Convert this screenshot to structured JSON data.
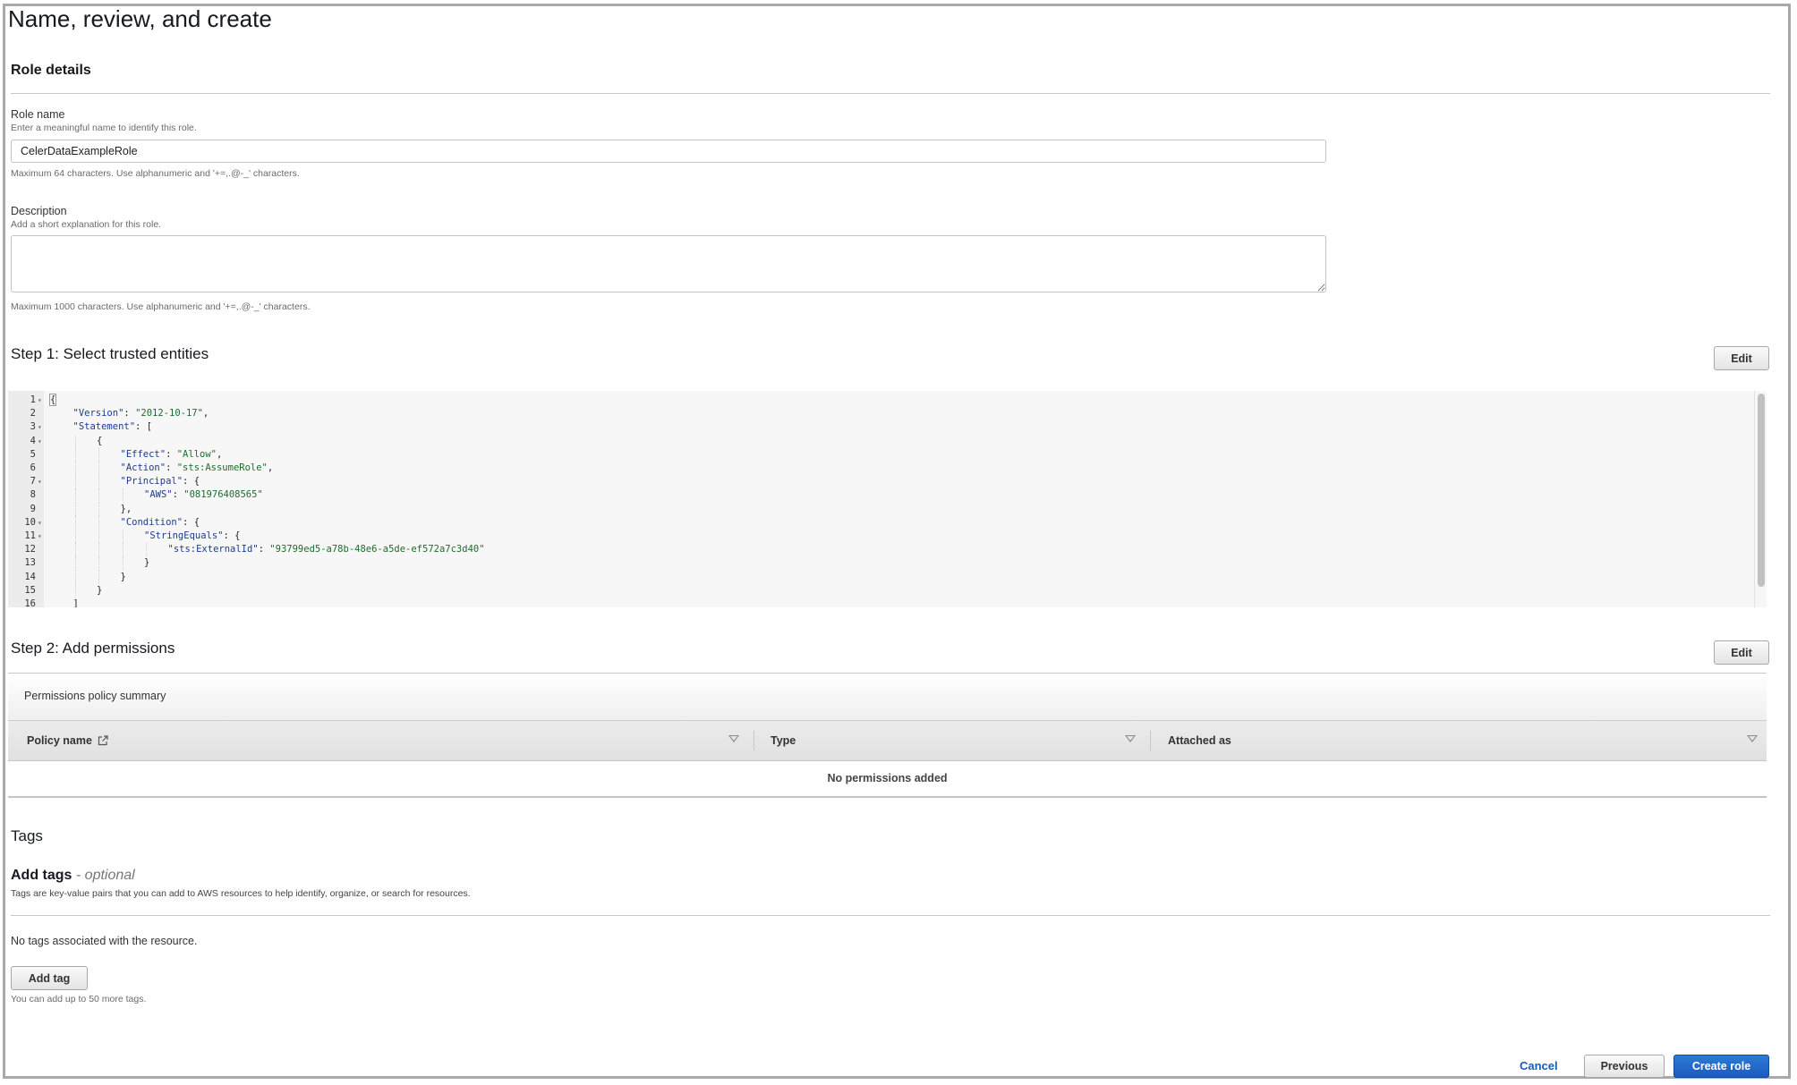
{
  "page": {
    "title": "Name, review, and create"
  },
  "role_details": {
    "heading": "Role details",
    "role_name": {
      "label": "Role name",
      "hint": "Enter a meaningful name to identify this role.",
      "value": "CelerDataExampleRole",
      "constraint": "Maximum 64 characters. Use alphanumeric and '+=,.@-_' characters."
    },
    "description": {
      "label": "Description",
      "hint": "Add a short explanation for this role.",
      "value": "",
      "constraint": "Maximum 1000 characters. Use alphanumeric and '+=,.@-_' characters."
    }
  },
  "step1": {
    "heading": "Step 1: Select trusted entities",
    "edit_label": "Edit",
    "code_lines": [
      {
        "n": "1",
        "fold": true,
        "indent": 0,
        "parts": [
          [
            "p",
            "{"
          ]
        ]
      },
      {
        "n": "2",
        "fold": false,
        "indent": 1,
        "parts": [
          [
            "k",
            "\"Version\""
          ],
          [
            "p",
            ": "
          ],
          [
            "s",
            "\"2012-10-17\""
          ],
          [
            "p",
            ","
          ]
        ]
      },
      {
        "n": "3",
        "fold": true,
        "indent": 1,
        "parts": [
          [
            "k",
            "\"Statement\""
          ],
          [
            "p",
            ": ["
          ]
        ]
      },
      {
        "n": "4",
        "fold": true,
        "indent": 2,
        "parts": [
          [
            "p",
            "{"
          ]
        ]
      },
      {
        "n": "5",
        "fold": false,
        "indent": 3,
        "parts": [
          [
            "k",
            "\"Effect\""
          ],
          [
            "p",
            ": "
          ],
          [
            "s",
            "\"Allow\""
          ],
          [
            "p",
            ","
          ]
        ]
      },
      {
        "n": "6",
        "fold": false,
        "indent": 3,
        "parts": [
          [
            "k",
            "\"Action\""
          ],
          [
            "p",
            ": "
          ],
          [
            "s",
            "\"sts:AssumeRole\""
          ],
          [
            "p",
            ","
          ]
        ]
      },
      {
        "n": "7",
        "fold": true,
        "indent": 3,
        "parts": [
          [
            "k",
            "\"Principal\""
          ],
          [
            "p",
            ": {"
          ]
        ]
      },
      {
        "n": "8",
        "fold": false,
        "indent": 4,
        "parts": [
          [
            "k",
            "\"AWS\""
          ],
          [
            "p",
            ": "
          ],
          [
            "s",
            "\"081976408565\""
          ]
        ]
      },
      {
        "n": "9",
        "fold": false,
        "indent": 3,
        "parts": [
          [
            "p",
            "},"
          ]
        ]
      },
      {
        "n": "10",
        "fold": true,
        "indent": 3,
        "parts": [
          [
            "k",
            "\"Condition\""
          ],
          [
            "p",
            ": {"
          ]
        ]
      },
      {
        "n": "11",
        "fold": true,
        "indent": 4,
        "parts": [
          [
            "k",
            "\"StringEquals\""
          ],
          [
            "p",
            ": {"
          ]
        ]
      },
      {
        "n": "12",
        "fold": false,
        "indent": 5,
        "parts": [
          [
            "k",
            "\"sts:ExternalId\""
          ],
          [
            "p",
            ": "
          ],
          [
            "s",
            "\"93799ed5-a78b-48e6-a5de-ef572a7c3d40\""
          ]
        ]
      },
      {
        "n": "13",
        "fold": false,
        "indent": 4,
        "parts": [
          [
            "p",
            "}"
          ]
        ]
      },
      {
        "n": "14",
        "fold": false,
        "indent": 3,
        "parts": [
          [
            "p",
            "}"
          ]
        ]
      },
      {
        "n": "15",
        "fold": false,
        "indent": 2,
        "parts": [
          [
            "p",
            "}"
          ]
        ]
      },
      {
        "n": "16",
        "fold": false,
        "indent": 1,
        "parts": [
          [
            "p",
            "]"
          ]
        ]
      }
    ]
  },
  "step2": {
    "heading": "Step 2: Add permissions",
    "edit_label": "Edit",
    "summary_title": "Permissions policy summary",
    "columns": [
      "Policy name",
      "Type",
      "Attached as"
    ],
    "empty_message": "No permissions added"
  },
  "tags": {
    "heading": "Tags",
    "add_tags_title": "Add tags",
    "add_tags_optional": "- optional",
    "description": "Tags are key-value pairs that you can add to AWS resources to help identify, organize, or search for resources.",
    "empty_message": "No tags associated with the resource.",
    "add_tag_label": "Add tag",
    "limit_hint": "You can add up to 50 more tags."
  },
  "footer": {
    "cancel_label": "Cancel",
    "previous_label": "Previous",
    "create_label": "Create role"
  },
  "colors": {
    "primary": "#1c5bbf",
    "link": "#1a5ab8",
    "json_key": "#1d3b8f",
    "json_string": "#1e6b2d"
  }
}
